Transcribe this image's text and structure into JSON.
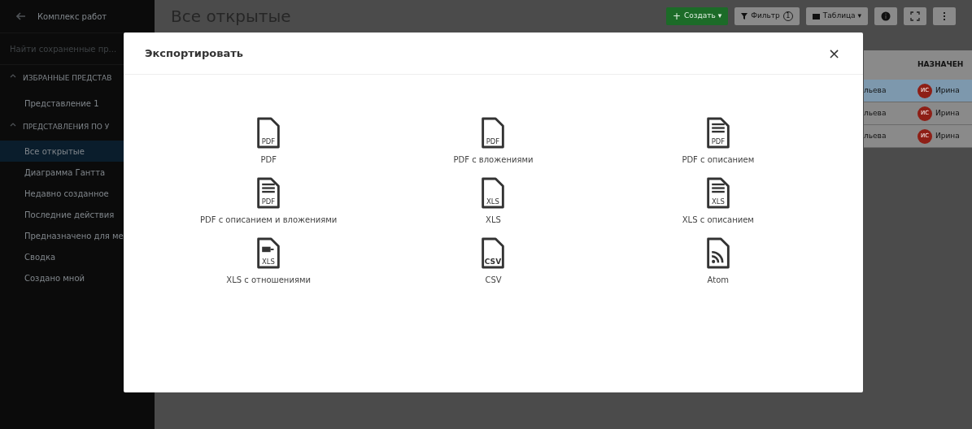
{
  "sidebar": {
    "back_title": "Комплекс работ",
    "search": {
      "placeholder": "Найти сохраненные пр..."
    },
    "sections": [
      {
        "title": "ИЗБРАННЫЕ ПРЕДСТАВ",
        "expanded": true,
        "items": [
          {
            "label": "Представление 1",
            "selected": false
          }
        ]
      },
      {
        "title": "ПРЕДСТАВЛЕНИЯ ПО У",
        "expanded": true,
        "items": [
          {
            "label": "Все открытые",
            "selected": true
          },
          {
            "label": "Диаграмма Гантта",
            "selected": false
          },
          {
            "label": "Недавно созданное",
            "selected": false
          },
          {
            "label": "Последние действия",
            "selected": false
          },
          {
            "label": "Предназначено для ме",
            "selected": false
          },
          {
            "label": "Сводка",
            "selected": false
          },
          {
            "label": "Создано мной",
            "selected": false
          }
        ]
      }
    ]
  },
  "header": {
    "title": "Все открытые",
    "create_icon": "+",
    "create_button": "Создать",
    "create_caret": "▾",
    "filter_button": "Фильтр",
    "filter_count": "1",
    "view_button": "Таблица",
    "view_caret": "▾"
  },
  "table": {
    "column": "НАЗНАЧЕН",
    "rows": [
      {
        "column_1": "льева",
        "initials": "ИС",
        "assignee": "Ирина",
        "selected": true
      },
      {
        "column_1": "льева",
        "initials": "ИС",
        "assignee": "Ирина",
        "selected": false
      },
      {
        "column_1": "льева",
        "initials": "ИС",
        "assignee": "Ирина",
        "selected": false
      }
    ]
  },
  "modal": {
    "title": "Экспортировать",
    "close": "×",
    "formats": [
      {
        "kind": "plain",
        "badge": "PDF",
        "label": "PDF"
      },
      {
        "kind": "plain",
        "badge": "PDF",
        "label": "PDF с вложениями"
      },
      {
        "kind": "lines",
        "badge": "PDF",
        "label": "PDF с описанием"
      },
      {
        "kind": "lines",
        "badge": "PDF",
        "label": "PDF с описанием и вложениями"
      },
      {
        "kind": "plain",
        "badge": "XLS",
        "label": "XLS"
      },
      {
        "kind": "lines",
        "badge": "XLS",
        "label": "XLS с описанием"
      },
      {
        "kind": "relation",
        "badge": "XLS",
        "label": "XLS с отношениями"
      },
      {
        "kind": "bold",
        "badge": "CSV",
        "label": "CSV"
      },
      {
        "kind": "feed",
        "label": "Atom"
      }
    ]
  }
}
